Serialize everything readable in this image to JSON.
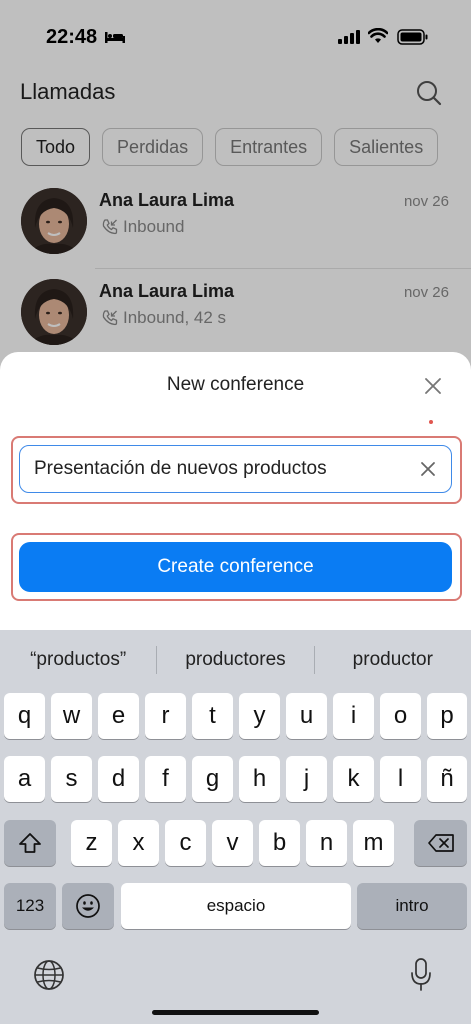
{
  "status_bar": {
    "time": "22:48"
  },
  "header": {
    "title": "Llamadas"
  },
  "filters": [
    "Todo",
    "Perdidas",
    "Entrantes",
    "Salientes"
  ],
  "calls": [
    {
      "name": "Ana Laura Lima",
      "detail": "Inbound",
      "date": "nov 26"
    },
    {
      "name": "Ana Laura Lima",
      "detail": "Inbound, 42 s",
      "date": "nov 26"
    }
  ],
  "sheet": {
    "title": "New conference",
    "input_value": "Presentación de nuevos productos",
    "create_label": "Create conference"
  },
  "keyboard": {
    "suggestions": [
      "“productos”",
      "productores",
      "productor"
    ],
    "row1": [
      "q",
      "w",
      "e",
      "r",
      "t",
      "y",
      "u",
      "i",
      "o",
      "p"
    ],
    "row2": [
      "a",
      "s",
      "d",
      "f",
      "g",
      "h",
      "j",
      "k",
      "l",
      "ñ"
    ],
    "row3": [
      "z",
      "x",
      "c",
      "v",
      "b",
      "n",
      "m"
    ],
    "numbers_label": "123",
    "space_label": "espacio",
    "return_label": "intro"
  },
  "colors": {
    "accent": "#0a7cf3",
    "highlight": "#d97a74"
  }
}
